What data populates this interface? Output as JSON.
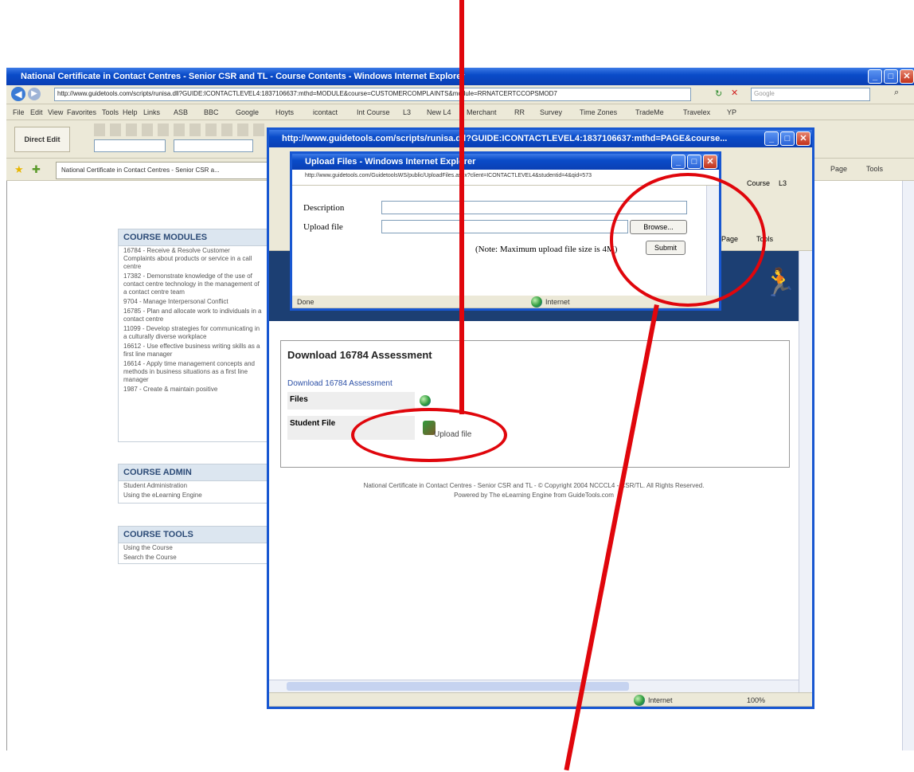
{
  "main_window": {
    "title": "National Certificate in Contact Centres - Senior CSR and TL - Course Contents - Windows Internet Explorer",
    "address": "http://www.guidetools.com/scripts/runisa.dll?GUIDE:ICONTACTLEVEL4:1837106637:mthd=MODULE&course=CUSTOMERCOMPLAINTS&module=RRNATCERTCCOPSMOD7",
    "search_placeholder": "Google",
    "menu": [
      "File",
      "Edit",
      "View",
      "Favorites",
      "Tools",
      "Help"
    ],
    "links_label": "Links",
    "links": [
      "ASB",
      "BBC",
      "Google",
      "Hoyts",
      "icontact",
      "Int Course",
      "L3",
      "New L4",
      "Merchant",
      "RR",
      "Survey",
      "Time Zones",
      "TradeMe",
      "Travelex",
      "YP"
    ],
    "direct_edit": "Direct Edit",
    "tab": "National Certificate in Contact Centres - Senior CSR a...",
    "tools_right": [
      "Page",
      "Tools"
    ]
  },
  "sidebar": {
    "modules_title": "COURSE MODULES",
    "modules": [
      "16784 - Receive & Resolve Customer Complaints about products or service in a call centre",
      "17382 - Demonstrate knowledge of the use of contact centre technology in the management of a contact centre team",
      "9704 - Manage Interpersonal Conflict",
      "16785 - Plan and allocate work to individuals in a contact centre",
      "11099 - Develop strategies for communicating in a culturally diverse workplace",
      "16612 - Use effective business writing skills as a first line manager",
      "16614 - Apply time management concepts and methods in business situations as a first line manager",
      "1987 - Create & maintain positive"
    ],
    "admin_title": "COURSE ADMIN",
    "admin": [
      "Student Administration",
      "Using the eLearning Engine"
    ],
    "tools_title": "COURSE TOOLS",
    "tools": [
      "Using the Course",
      "Search the Course"
    ]
  },
  "popup": {
    "title": "http://www.guidetools.com/scripts/runisa.dll?GUIDE:ICONTACTLEVEL4:1837106637:mthd=PAGE&course...",
    "tabs_right": [
      "Course",
      "L3"
    ],
    "tools_right": [
      "Page",
      "Tools"
    ],
    "download_heading": "Download 16784 Assessment",
    "download_link": "Download 16784 Assessment",
    "files_label": "Files",
    "student_file_label": "Student File",
    "upload_link": "Upload file",
    "footer_line1": "National Certificate in Contact Centres - Senior CSR and TL - © Copyright 2004 NCCCL4 - CSR/TL. All Rights Reserved.",
    "footer_line2": "Powered by The eLearning Engine from GuideTools.com",
    "status_zone": "Internet",
    "zoom": "100%"
  },
  "upload_dialog": {
    "title": "Upload Files - Windows Internet Explorer",
    "address": "http://www.guidetools.com/GuidetoolsWS/public/UploadFiles.aspx?client=ICONTACTLEVEL4&studentid=4&qid=573",
    "description_label": "Description",
    "upload_label": "Upload file",
    "browse_label": "Browse...",
    "note": "(Note: Maximum upload file size is 4M)",
    "submit_label": "Submit",
    "status_done": "Done",
    "status_zone": "Internet"
  },
  "colors": {
    "annotation": "#e0060c",
    "xp_blue": "#0a4cc9",
    "sidebar_head": "#2c4b77"
  }
}
